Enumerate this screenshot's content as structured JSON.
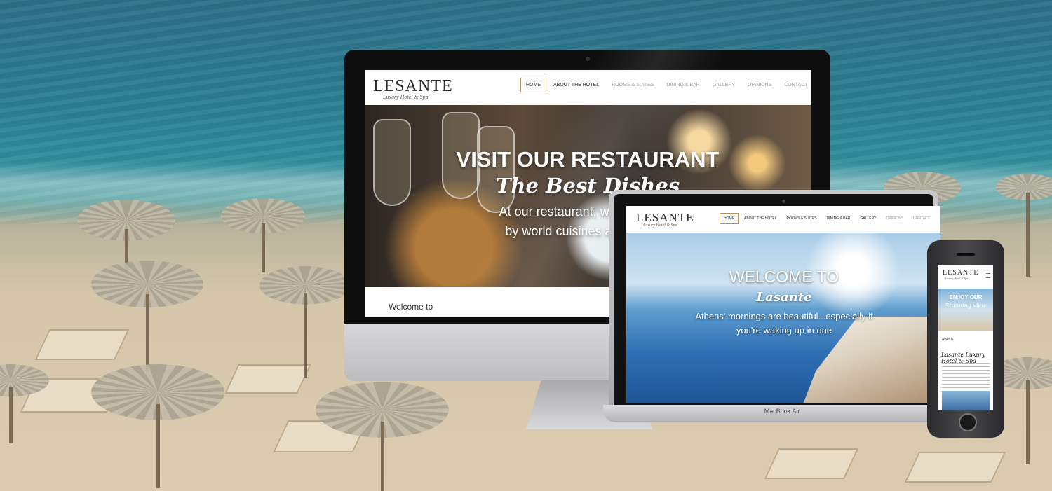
{
  "imac": {
    "logo_main": "LESANTE",
    "logo_tag": "Luxury Hotel & Spa",
    "nav": [
      "HOME",
      "ABOUT THE HOTEL",
      "ROOMS & SUITES",
      "DINING & BAR",
      "GALLERY",
      "OPINIONS",
      "CONTACT"
    ],
    "hero_title": "VISIT OUR RESTAURANT",
    "hero_script": "The Best Dishes",
    "hero_line1": "At our restaurant, we offer a var",
    "hero_line2": "by world cuisines and cooked",
    "welcome": "Welcome to",
    "apple_glyph": ""
  },
  "macbook": {
    "logo_main": "LESANTE",
    "logo_tag": "Luxury Hotel & Spa",
    "nav": [
      "HOME",
      "ABOUT THE HOTEL",
      "ROOMS & SUITES",
      "DINING & BAR",
      "GALLERY",
      "OPINIONS",
      "CONTACT"
    ],
    "hero_title": "WELCOME TO",
    "hero_script": "Lasante",
    "hero_line1": "Athens' mornings are beautiful...especially if",
    "hero_line2": "you're waking up in one",
    "label": "MacBook Air"
  },
  "phone": {
    "logo_main": "LESANTE",
    "logo_tag": "Luxury Hotel & Spa",
    "hero_title": "ENJOY OUR",
    "hero_script": "Stunning view",
    "about": "ABOUT",
    "title": "Lasante Luxury Hotel & Spa"
  }
}
